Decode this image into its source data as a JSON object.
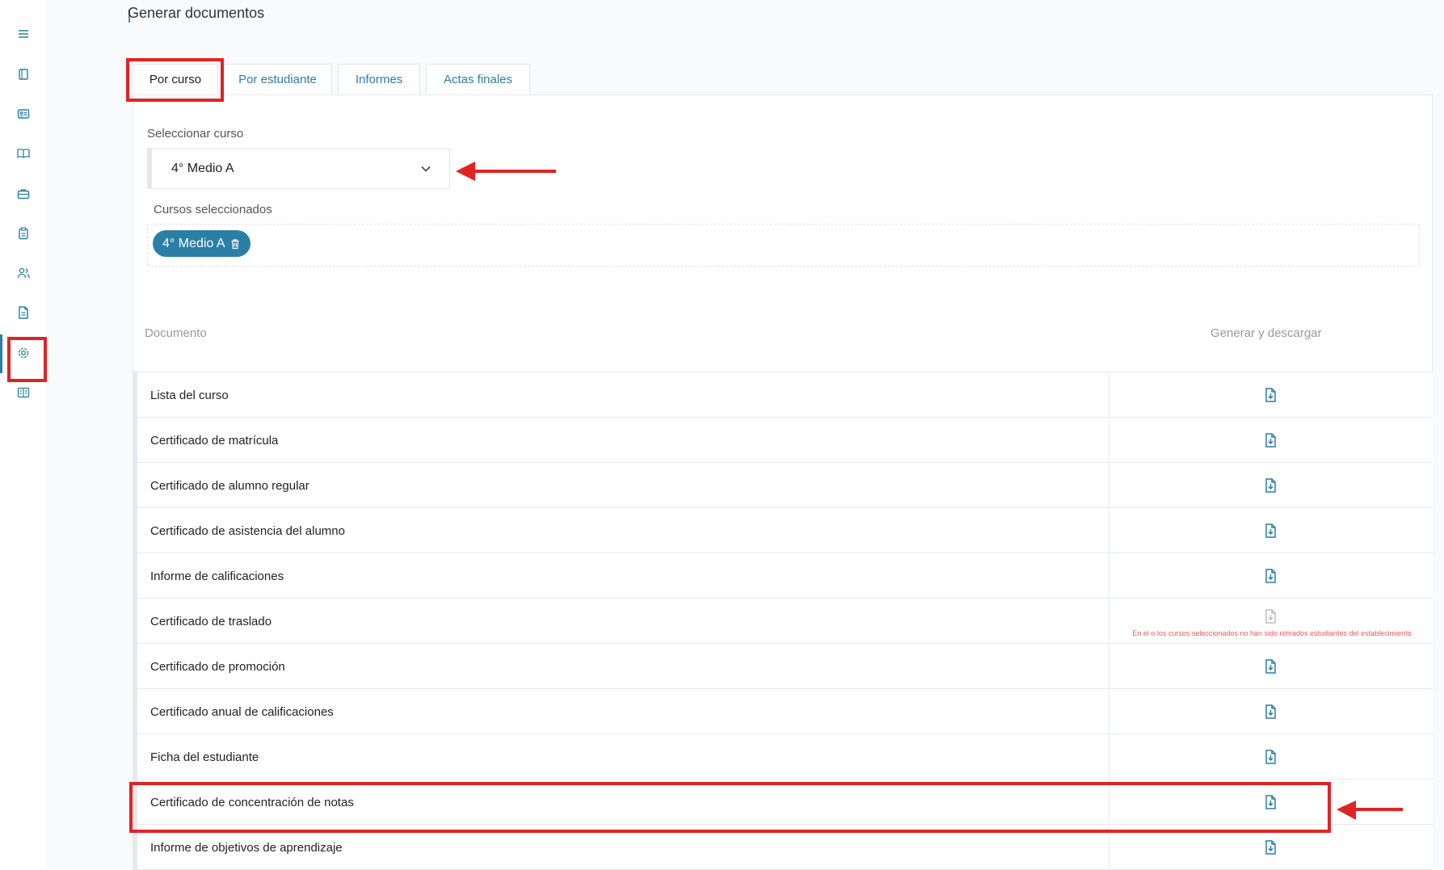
{
  "page": {
    "title": "Generar documentos"
  },
  "sidebar": {
    "items": [
      {
        "icon": "menu-icon"
      },
      {
        "icon": "book-icon"
      },
      {
        "icon": "id-card-icon"
      },
      {
        "icon": "open-book-icon"
      },
      {
        "icon": "briefcase-icon"
      },
      {
        "icon": "clipboard-icon"
      },
      {
        "icon": "users-icon"
      },
      {
        "icon": "document-icon",
        "active": true
      },
      {
        "icon": "gear-icon"
      },
      {
        "icon": "manual-icon"
      }
    ]
  },
  "tabs": [
    {
      "label": "Por curso",
      "active": true
    },
    {
      "label": "Por estudiante"
    },
    {
      "label": "Informes"
    },
    {
      "label": "Actas finales"
    }
  ],
  "form": {
    "select_label": "Seleccionar curso",
    "select_value": "4° Medio A",
    "selected_label": "Cursos seleccionados",
    "chip": "4° Medio A"
  },
  "table": {
    "header_document": "Documento",
    "header_generate": "Generar y descargar",
    "rows": [
      {
        "label": "Lista del curso"
      },
      {
        "label": "Certificado de matrícula"
      },
      {
        "label": "Certificado de alumno regular"
      },
      {
        "label": "Certificado de asistencia del alumno"
      },
      {
        "label": "Informe de calificaciones"
      },
      {
        "label": "Certificado de traslado",
        "disabled": true,
        "warning": "En el o los cursos seleccionados no han sido retirados estudiantes del establecimiento"
      },
      {
        "label": "Certificado de promoción"
      },
      {
        "label": "Certificado anual de calificaciones"
      },
      {
        "label": "Ficha del estudiante"
      },
      {
        "label": "Certificado de concentración de notas",
        "highlighted": true
      },
      {
        "label": "Informe de objetivos de aprendizaje"
      }
    ]
  },
  "colors": {
    "accent": "#2b7fa6",
    "annotation": "#e02424",
    "warning": "#e25a5a"
  }
}
